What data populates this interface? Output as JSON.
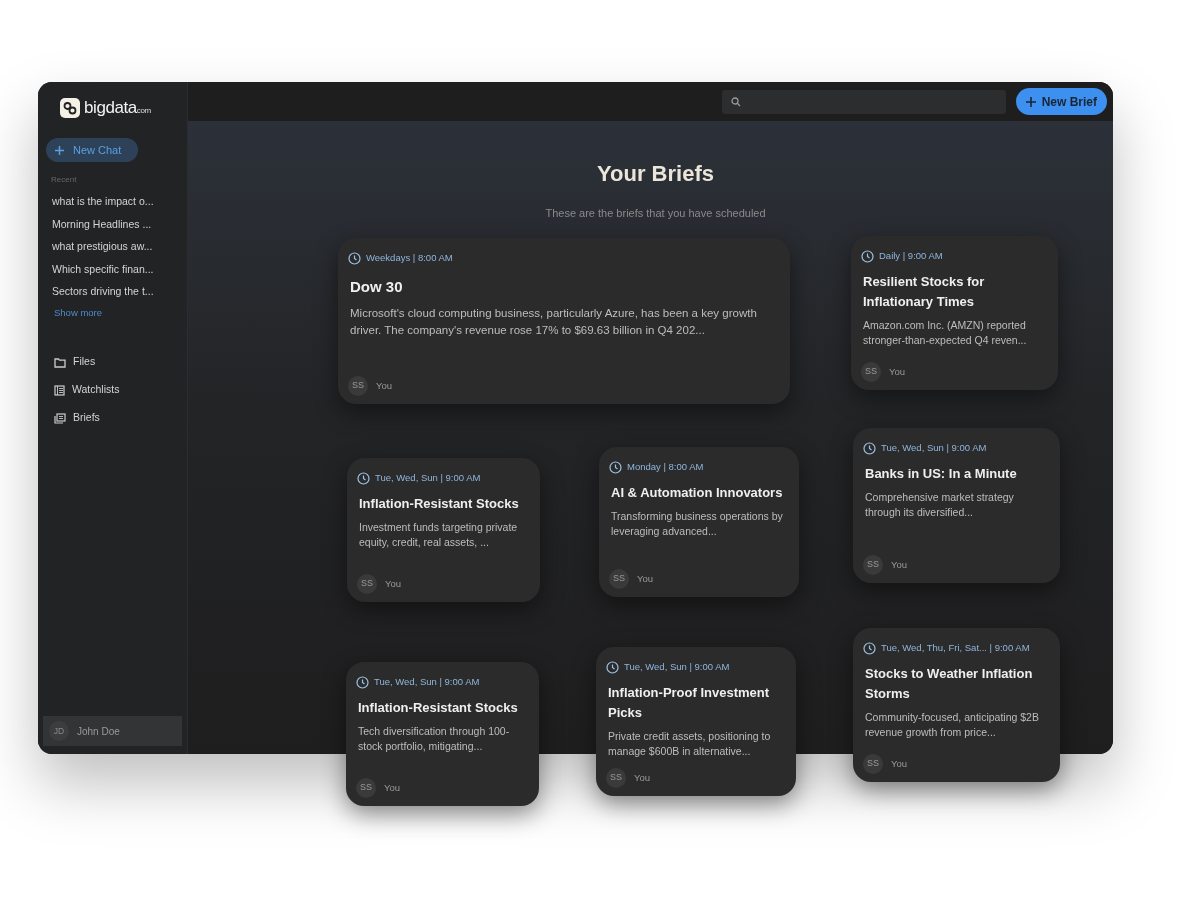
{
  "logo": {
    "name": "bigdata",
    "suffix": "com"
  },
  "sidebar": {
    "new_chat": "New Chat",
    "recent_label": "Recent",
    "recent": [
      "what is the impact o...",
      "Morning Headlines ...",
      "what prestigious aw...",
      "Which specific finan...",
      "Sectors driving the t..."
    ],
    "show_more": "Show more",
    "nav": [
      "Files",
      "Watchlists",
      "Briefs"
    ],
    "user": {
      "initials": "JD",
      "name": "John Doe"
    }
  },
  "header": {
    "button": "New Brief"
  },
  "title": "Your Briefs",
  "subtitle": "These are the briefs that you have scheduled",
  "briefs": [
    {
      "schedule": "Weekdays | 8:00 AM",
      "title": "Dow 30",
      "summary": "Microsoft's cloud computing business, particularly Azure, has been a key growth driver. The company's revenue rose 17% to $69.63 billion in Q4 202...",
      "initials": "SS",
      "author": "You"
    },
    {
      "schedule": "Daily | 9:00 AM",
      "title": "Resilient Stocks for Inflationary Times",
      "summary": "Amazon.com Inc. (AMZN) reported stronger-than-expected Q4 reven...",
      "initials": "SS",
      "author": "You"
    },
    {
      "schedule": "Tue, Wed, Sun | 9:00 AM",
      "title": "Inflation-Resistant Stocks",
      "summary": "Investment funds targeting private equity, credit, real assets, ...",
      "initials": "SS",
      "author": "You"
    },
    {
      "schedule": "Monday | 8:00 AM",
      "title": "AI & Automation Innovators",
      "summary": "Transforming business operations by leveraging advanced...",
      "initials": "SS",
      "author": "You"
    },
    {
      "schedule": "Tue, Wed, Sun | 9:00 AM",
      "title": "Banks in US: In a Minute",
      "summary": "Comprehensive market strategy through its diversified...",
      "initials": "SS",
      "author": "You"
    },
    {
      "schedule": "Tue, Wed, Sun | 9:00 AM",
      "title": "Inflation-Resistant Stocks",
      "summary": "Tech diversification through 100-stock portfolio, mitigating...",
      "initials": "SS",
      "author": "You"
    },
    {
      "schedule": "Tue, Wed, Sun | 9:00 AM",
      "title": "Inflation-Proof Investment Picks",
      "summary": "Private credit assets, positioning to manage $600B in alternative...",
      "initials": "SS",
      "author": "You"
    },
    {
      "schedule": "Tue, Wed, Thu, Fri, Sat... | 9:00 AM",
      "title": "Stocks to Weather Inflation Storms",
      "summary": "Community-focused, anticipating $2B revenue growth from price...",
      "initials": "SS",
      "author": "You"
    }
  ]
}
